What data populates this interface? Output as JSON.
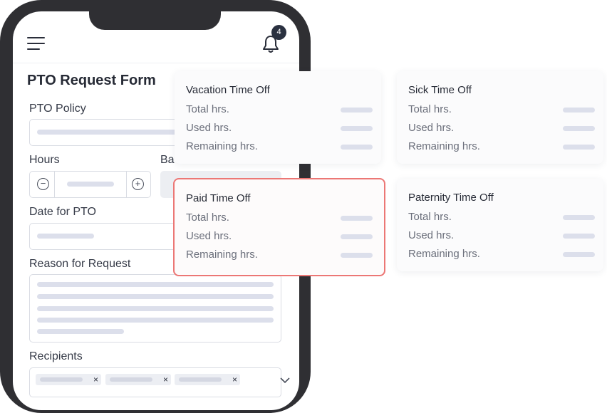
{
  "header": {
    "notification_count": "4"
  },
  "form": {
    "title": "PTO Request Form",
    "pto_policy_label": "PTO Policy",
    "hours_label": "Hours",
    "balance_label": "Ba",
    "date_label": "Date for PTO",
    "reason_label": "Reason for Request",
    "recipients_label": "Recipients",
    "stepper_minus": "−",
    "stepper_plus": "+",
    "chip_remove": "×"
  },
  "cards": [
    {
      "title": "Vacation Time Off",
      "rows": [
        "Total hrs.",
        "Used hrs.",
        "Remaining hrs."
      ]
    },
    {
      "title": "Sick Time Off",
      "rows": [
        "Total hrs.",
        "Used hrs.",
        "Remaining hrs."
      ]
    },
    {
      "title": "Paid Time Off",
      "rows": [
        "Total hrs.",
        "Used hrs.",
        "Remaining hrs."
      ]
    },
    {
      "title": "Paternity Time Off",
      "rows": [
        "Total hrs.",
        "Used hrs.",
        "Remaining hrs."
      ]
    }
  ],
  "colors": {
    "highlight": "#ec7775",
    "phone_frame": "#2f2f33",
    "placeholder_bar": "#dcdfeb"
  },
  "icons": [
    "hamburger-menu-icon",
    "bell-icon",
    "minus-circle-icon",
    "plus-circle-icon",
    "chevron-down-icon",
    "close-icon"
  ]
}
